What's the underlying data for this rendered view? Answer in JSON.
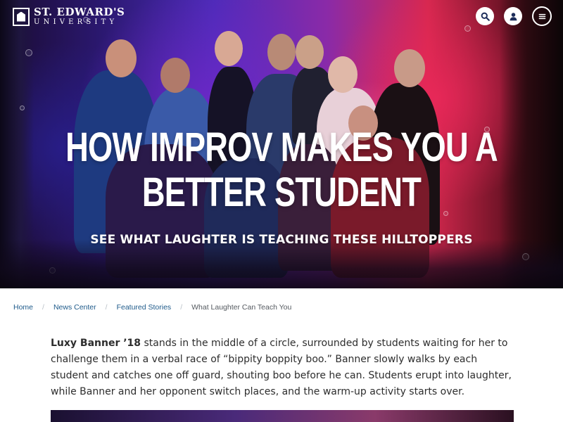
{
  "header": {
    "logo": {
      "line1": "ST. EDWARD'S",
      "line2": "UNIVERSITY"
    },
    "icons": {
      "search": "search-icon",
      "account": "user-icon",
      "menu": "menu-icon"
    }
  },
  "hero": {
    "title": "HOW IMPROV MAKES YOU A BETTER STUDENT",
    "subtitle": "SEE WHAT LAUGHTER IS TEACHING THESE HILLTOPPERS"
  },
  "breadcrumb": {
    "items": [
      {
        "label": "Home"
      },
      {
        "label": "News Center"
      },
      {
        "label": "Featured Stories"
      }
    ],
    "current": "What Laughter Can Teach You"
  },
  "article": {
    "lead_name": "Luxy Banner ’18",
    "lead_text": " stands in the middle of a circle, surrounded by students waiting for her to challenge them in a verbal race of “bippity boppity boo.” Banner slowly walks by each student and catches one off guard, shouting boo before he can. Students erupt into laughter, while Banner and her opponent switch places, and the warm-up activity starts over."
  },
  "colors": {
    "link": "#1e5a8a",
    "text": "#2d2d2d",
    "hero_blue": "#4c2bb8",
    "hero_red": "#d6284f"
  }
}
